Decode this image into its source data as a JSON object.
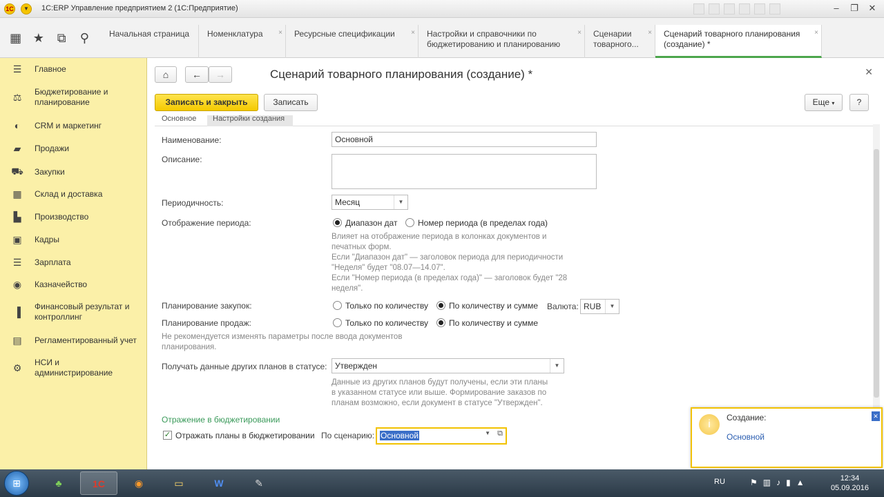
{
  "window": {
    "title": "1C:ERP Управление предприятием 2 (1С:Предприятие)"
  },
  "nav": {
    "tabs": [
      {
        "label": "Начальная страница"
      },
      {
        "label": "Номенклатура"
      },
      {
        "label": "Ресурсные спецификации"
      },
      {
        "label": "Настройки и справочники по бюджетированию и планированию"
      },
      {
        "label": "Сценарии товарного..."
      },
      {
        "label": "Сценарий товарного планирования (создание) *"
      }
    ]
  },
  "sidebar": {
    "items": [
      {
        "label": "Главное",
        "icon": "menu-icon"
      },
      {
        "label": "Бюджетирование и планирование",
        "icon": "budget-icon"
      },
      {
        "label": "CRM и маркетинг",
        "icon": "crm-icon"
      },
      {
        "label": "Продажи",
        "icon": "sales-icon"
      },
      {
        "label": "Закупки",
        "icon": "cart-icon"
      },
      {
        "label": "Склад и доставка",
        "icon": "warehouse-icon"
      },
      {
        "label": "Производство",
        "icon": "production-icon"
      },
      {
        "label": "Кадры",
        "icon": "hr-icon"
      },
      {
        "label": "Зарплата",
        "icon": "salary-icon"
      },
      {
        "label": "Казначейство",
        "icon": "treasury-icon"
      },
      {
        "label": "Финансовый результат и контроллинг",
        "icon": "finance-icon"
      },
      {
        "label": "Регламентированный учет",
        "icon": "accounting-icon"
      },
      {
        "label": "НСИ и администрирование",
        "icon": "gear-icon"
      }
    ]
  },
  "form": {
    "title": "Сценарий товарного планирования (создание) *",
    "save_close": "Записать и закрыть",
    "save": "Записать",
    "more": "Еще",
    "help": "?",
    "subtabs": [
      "Основное",
      "Настройки создания"
    ],
    "name_label": "Наименование:",
    "name_value": "Основной",
    "desc_label": "Описание:",
    "period_label": "Периодичность:",
    "period_value": "Месяц",
    "display_label": "Отображение периода:",
    "display_opt1": "Диапазон дат",
    "display_opt2": "Номер периода (в пределах года)",
    "display_hint_1": "Влияет на отображение периода в колонках документов и",
    "display_hint_2": "печатных форм.",
    "display_hint_3": "Если \"Диапазон дат\" — заголовок периода для периодичности",
    "display_hint_4": "\"Неделя\" будет \"08.07—14.07\".",
    "display_hint_5": "Если \"Номер периода (в пределах года)\" — заголовок будет \"28",
    "display_hint_6": "неделя\".",
    "purchase_label": "Планирование закупок:",
    "purchase_opt1": "Только по количеству",
    "purchase_opt2": "По количеству и сумме",
    "currency_label": "Валюта:",
    "currency_value": "RUB",
    "sales_label": "Планирование продаж:",
    "sales_opt1": "Только по количеству",
    "sales_opt2": "По количеству и сумме",
    "warn_hint_1": "Не рекомендуется изменять параметры после ввода документов",
    "warn_hint_2": "планирования.",
    "status_label": "Получать данные других планов в статусе:",
    "status_value": "Утвержден",
    "status_hint_1": "Данные из других планов будут получены, если эти планы",
    "status_hint_2": "в указанном статусе или выше. Формирование заказов по",
    "status_hint_3": "планам возможно, если документ в статусе \"Утвержден\".",
    "budget_section": "Отражение в бюджетировании",
    "budget_check_label": "Отражать планы в бюджетировании",
    "scenario_label": "По сценарию:",
    "scenario_value": "Основной"
  },
  "notification": {
    "title": "Создание:",
    "link": "Основной"
  },
  "taskbar": {
    "lang": "RU",
    "time": "12:34",
    "date": "05.09.2016"
  },
  "colors": {
    "sidebar_bg": "#fbf0a8",
    "accent_yellow": "#f4c900",
    "section_green": "#3a9a5a",
    "active_tab": "#4ca64c"
  }
}
